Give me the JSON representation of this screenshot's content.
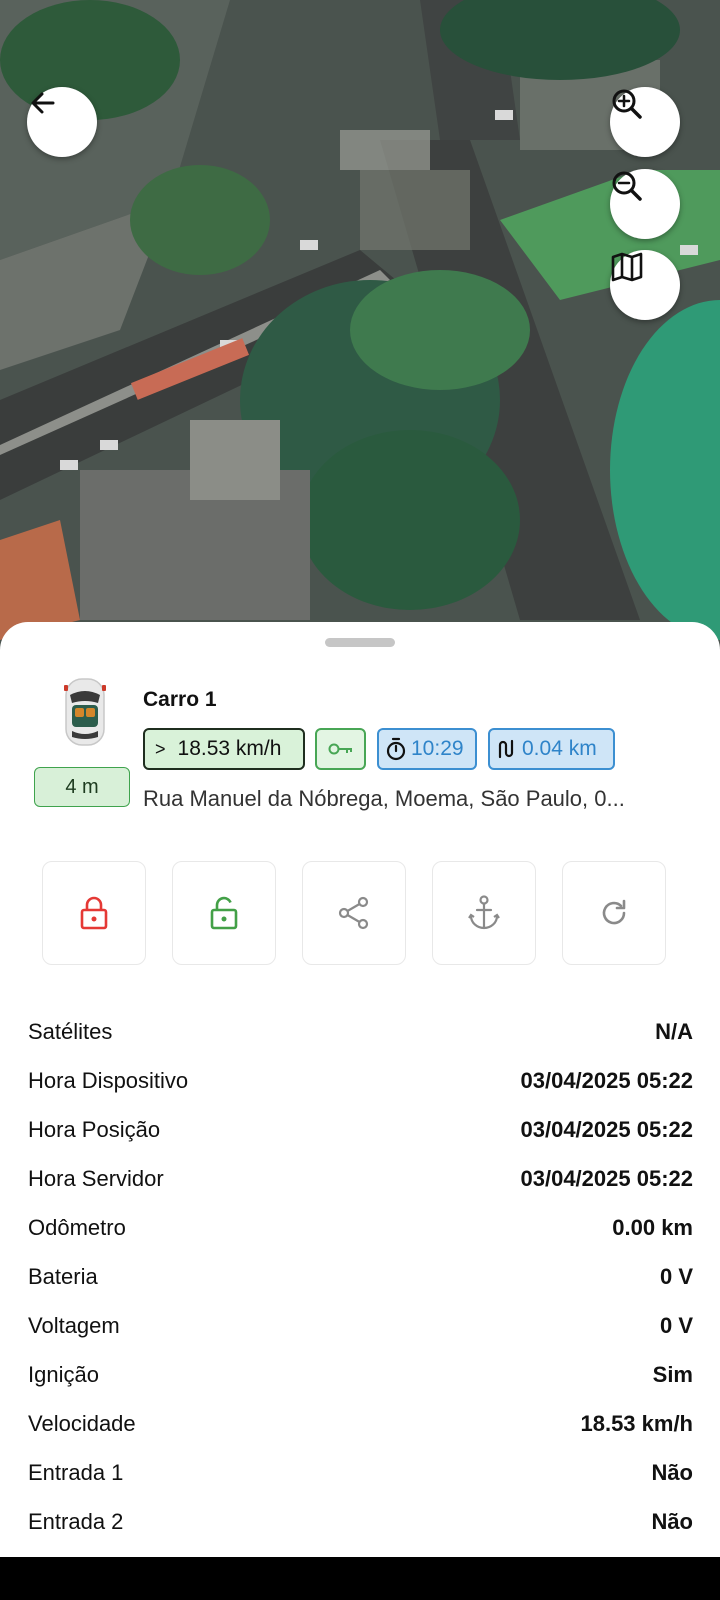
{
  "map": {
    "back_icon": "arrow-left-icon",
    "zoom_in_icon": "zoom-in-icon",
    "zoom_out_icon": "zoom-out-icon",
    "layers_icon": "map-icon"
  },
  "vehicle": {
    "name": "Carro 1",
    "age": "4 m",
    "speed": "18.53 km/h",
    "duration": "10:29",
    "distance": "0.04 km",
    "address": "Rua Manuel da Nóbrega, Moema, São Paulo, 0..."
  },
  "colors": {
    "lock": "#e53935",
    "unlock": "#43a047",
    "neutral_icon": "#8a8a8a",
    "chip_blue": "#2f84c9",
    "chip_green": "#48a655"
  },
  "actions": [
    {
      "name": "lock",
      "icon": "lock-icon"
    },
    {
      "name": "unlock",
      "icon": "unlock-icon"
    },
    {
      "name": "share",
      "icon": "share-icon"
    },
    {
      "name": "anchor",
      "icon": "anchor-icon"
    },
    {
      "name": "refresh",
      "icon": "refresh-icon"
    }
  ],
  "info": [
    {
      "label": "Satélites",
      "value": "N/A"
    },
    {
      "label": "Hora Dispositivo",
      "value": "03/04/2025 05:22"
    },
    {
      "label": "Hora Posição",
      "value": "03/04/2025 05:22"
    },
    {
      "label": "Hora Servidor",
      "value": "03/04/2025 05:22"
    },
    {
      "label": "Odômetro",
      "value": "0.00 km"
    },
    {
      "label": "Bateria",
      "value": "0 V"
    },
    {
      "label": "Voltagem",
      "value": "0 V"
    },
    {
      "label": "Ignição",
      "value": "Sim"
    },
    {
      "label": "Velocidade",
      "value": "18.53 km/h"
    },
    {
      "label": "Entrada 1",
      "value": "Não"
    },
    {
      "label": "Entrada 2",
      "value": "Não"
    }
  ]
}
